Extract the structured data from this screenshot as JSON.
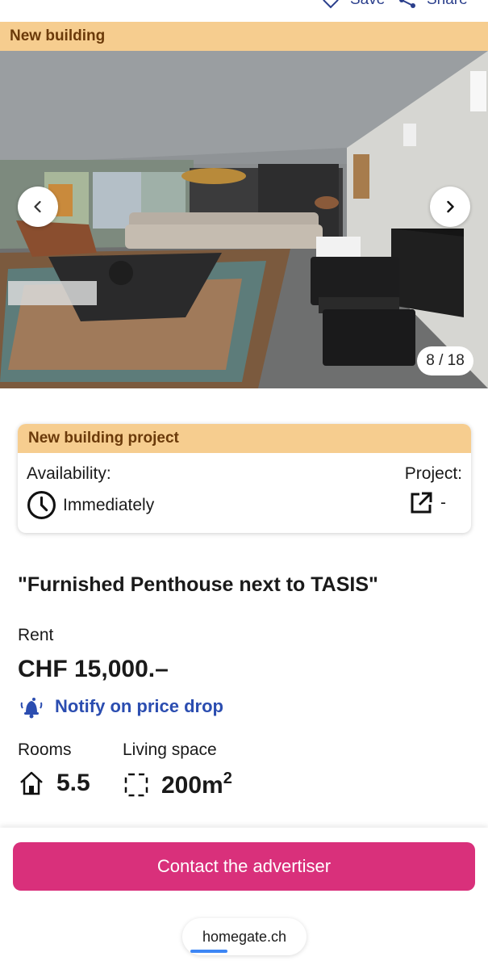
{
  "top_actions": {
    "save_label": "Save",
    "share_label": "Share"
  },
  "badge": "New building",
  "gallery": {
    "counter": "8 / 18"
  },
  "project_card": {
    "header": "New building project",
    "availability_label": "Availability:",
    "availability_value": "Immediately",
    "project_label": "Project:",
    "project_value": "-"
  },
  "listing": {
    "title": "\"Furnished Penthouse next to TASIS\"",
    "rent_label": "Rent",
    "price": "CHF 15,000.–",
    "notify_label": "Notify on price drop",
    "rooms_label": "Rooms",
    "rooms_value": "5.5",
    "space_label": "Living space",
    "space_value": "200m",
    "space_unit_sup": "2"
  },
  "cta": {
    "contact_label": "Contact the advertiser"
  },
  "browser": {
    "url": "homegate.ch"
  },
  "colors": {
    "accent_blue": "#2b4db0",
    "badge_bg": "#f6cd8f",
    "cta_pink": "#d9307b"
  }
}
